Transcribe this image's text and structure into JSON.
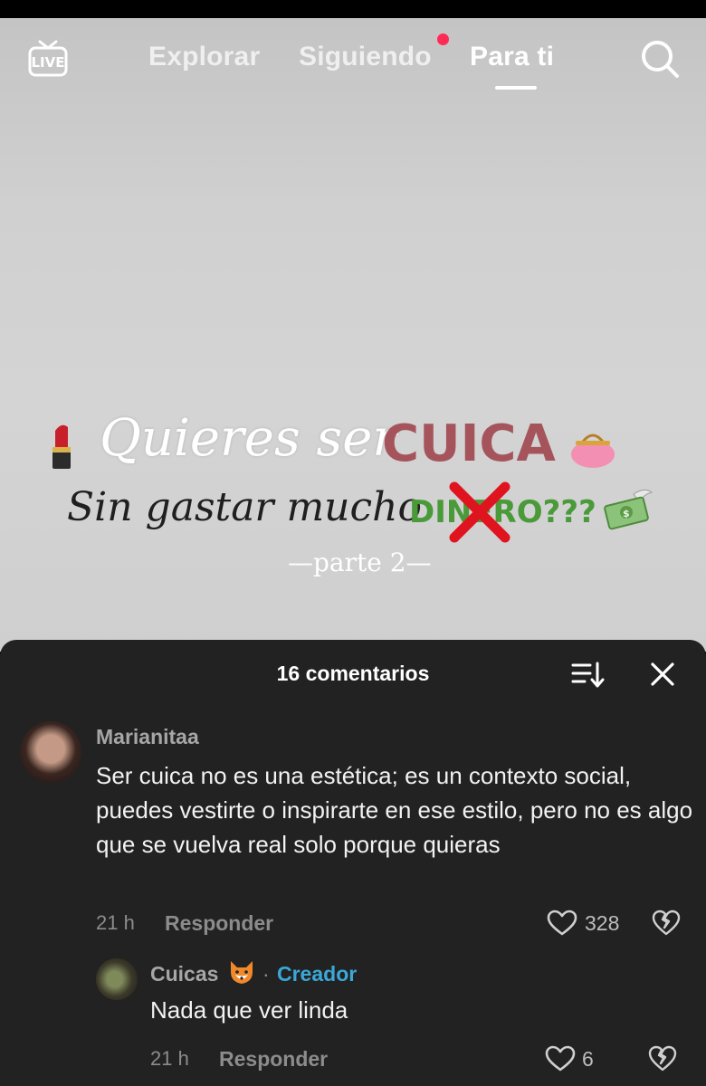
{
  "nav": {
    "live_label": "LIVE",
    "tabs": [
      {
        "label": "Explorar"
      },
      {
        "label": "Siguiendo"
      },
      {
        "label": "Para ti"
      }
    ],
    "active_tab": "Para ti",
    "icons": {
      "live": "live-tv-icon",
      "search": "search-icon"
    },
    "accent_color": "#fe2c55"
  },
  "video": {
    "line1_script": "Quieres ser",
    "line1_bold": "CUICA",
    "line2_script": "Sin gastar mucho",
    "line2_bold": "DINERO???",
    "line3": "—parte 2—",
    "decorations": [
      "lipstick-emoji",
      "purse-emoji",
      "money-emoji",
      "red-x-mark"
    ]
  },
  "comments_panel": {
    "title": "16 comentarios",
    "icons": {
      "sort": "sort-icon",
      "close": "close-icon"
    },
    "comment": {
      "user": "Marianitaa",
      "text": "Ser cuica no es una estética; es un contexto social, puedes vestirte o inspirarte en ese estilo, pero no es algo que se vuelva real solo porque quieras",
      "time": "21 h",
      "reply_label": "Responder",
      "likes": "328"
    },
    "reply": {
      "user": "Cuicas",
      "user_emoji": "fox-emoji",
      "separator": "·",
      "badge": "Creador",
      "text": "Nada que ver linda",
      "time": "21 h",
      "reply_label": "Responder",
      "likes": "6"
    },
    "colors": {
      "panel_bg": "#222222",
      "creator_badge": "#3aa8d8"
    }
  }
}
